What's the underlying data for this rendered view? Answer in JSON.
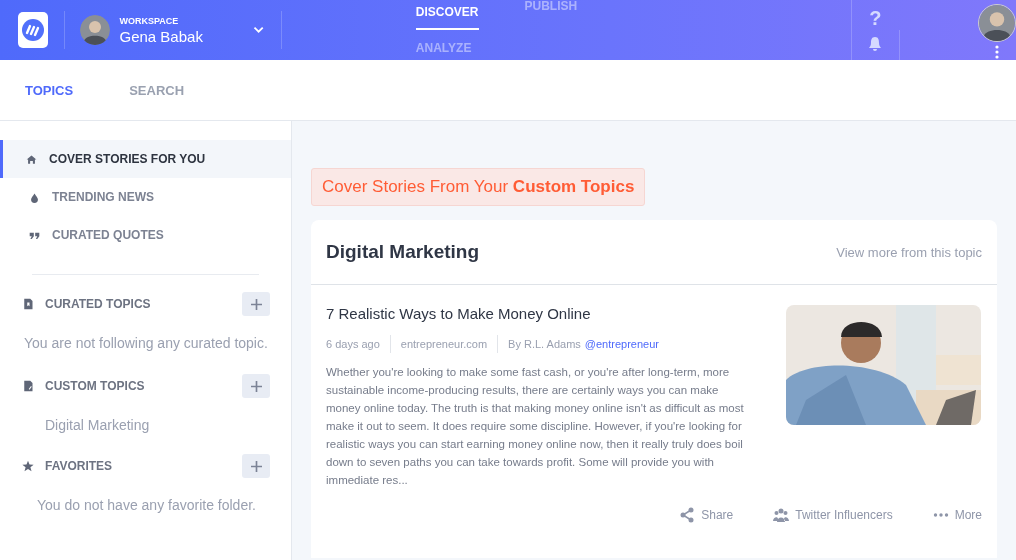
{
  "header": {
    "workspace": {
      "label": "WORKSPACE",
      "name": "Gena Babak"
    },
    "nav": [
      {
        "label": "DISCOVER",
        "selected": true
      },
      {
        "label": "PUBLISH",
        "selected": false
      },
      {
        "label": "ANALYZE",
        "selected": false
      }
    ],
    "help": "?"
  },
  "tabs": [
    {
      "label": "TOPICS",
      "selected": true
    },
    {
      "label": "SEARCH",
      "selected": false
    }
  ],
  "sidebar": {
    "items": [
      {
        "label": "COVER STORIES FOR YOU",
        "kind": "home",
        "selected": true
      },
      {
        "label": "TRENDING NEWS",
        "kind": "drop",
        "selected": false
      },
      {
        "label": "CURATED QUOTES",
        "kind": "quote",
        "selected": false
      }
    ],
    "sections": [
      {
        "title": "CURATED TOPICS",
        "kind": "bookmark",
        "empty_text": "You are not following any curated topic."
      },
      {
        "title": "CUSTOM TOPICS",
        "kind": "file",
        "items": [
          "Digital Marketing"
        ]
      },
      {
        "title": "FAVORITES",
        "kind": "star",
        "empty_text": "You do not have any favorite folder."
      }
    ]
  },
  "banner": "Cover Stories From Your **Custom Topics**",
  "card": {
    "title": "Digital Marketing",
    "link": "View more from this topic",
    "article": {
      "title": "7 Realistic Ways to Make Money Online",
      "age": "6 days ago",
      "source": "entrepreneur.com",
      "author": "By R.L. Adams",
      "handle": "@entrepreneur",
      "summary": "Whether you're looking to make some fast cash, or you're after long-term, more sustainable income-producing results, there are certainly ways you can make money online today. The truth is that making money online isn't as difficult as most make it out to seem. It does require some discipline. However, if you're looking for realistic ways you can start earning money online now, then it really truly does boil down to seven paths you can take towards profit. Some will provide you with immediate res..."
    },
    "actions": [
      {
        "label": "Share",
        "kind": "share"
      },
      {
        "label": "Twitter Influencers",
        "kind": "people"
      },
      {
        "label": "More",
        "kind": "dots"
      }
    ]
  }
}
